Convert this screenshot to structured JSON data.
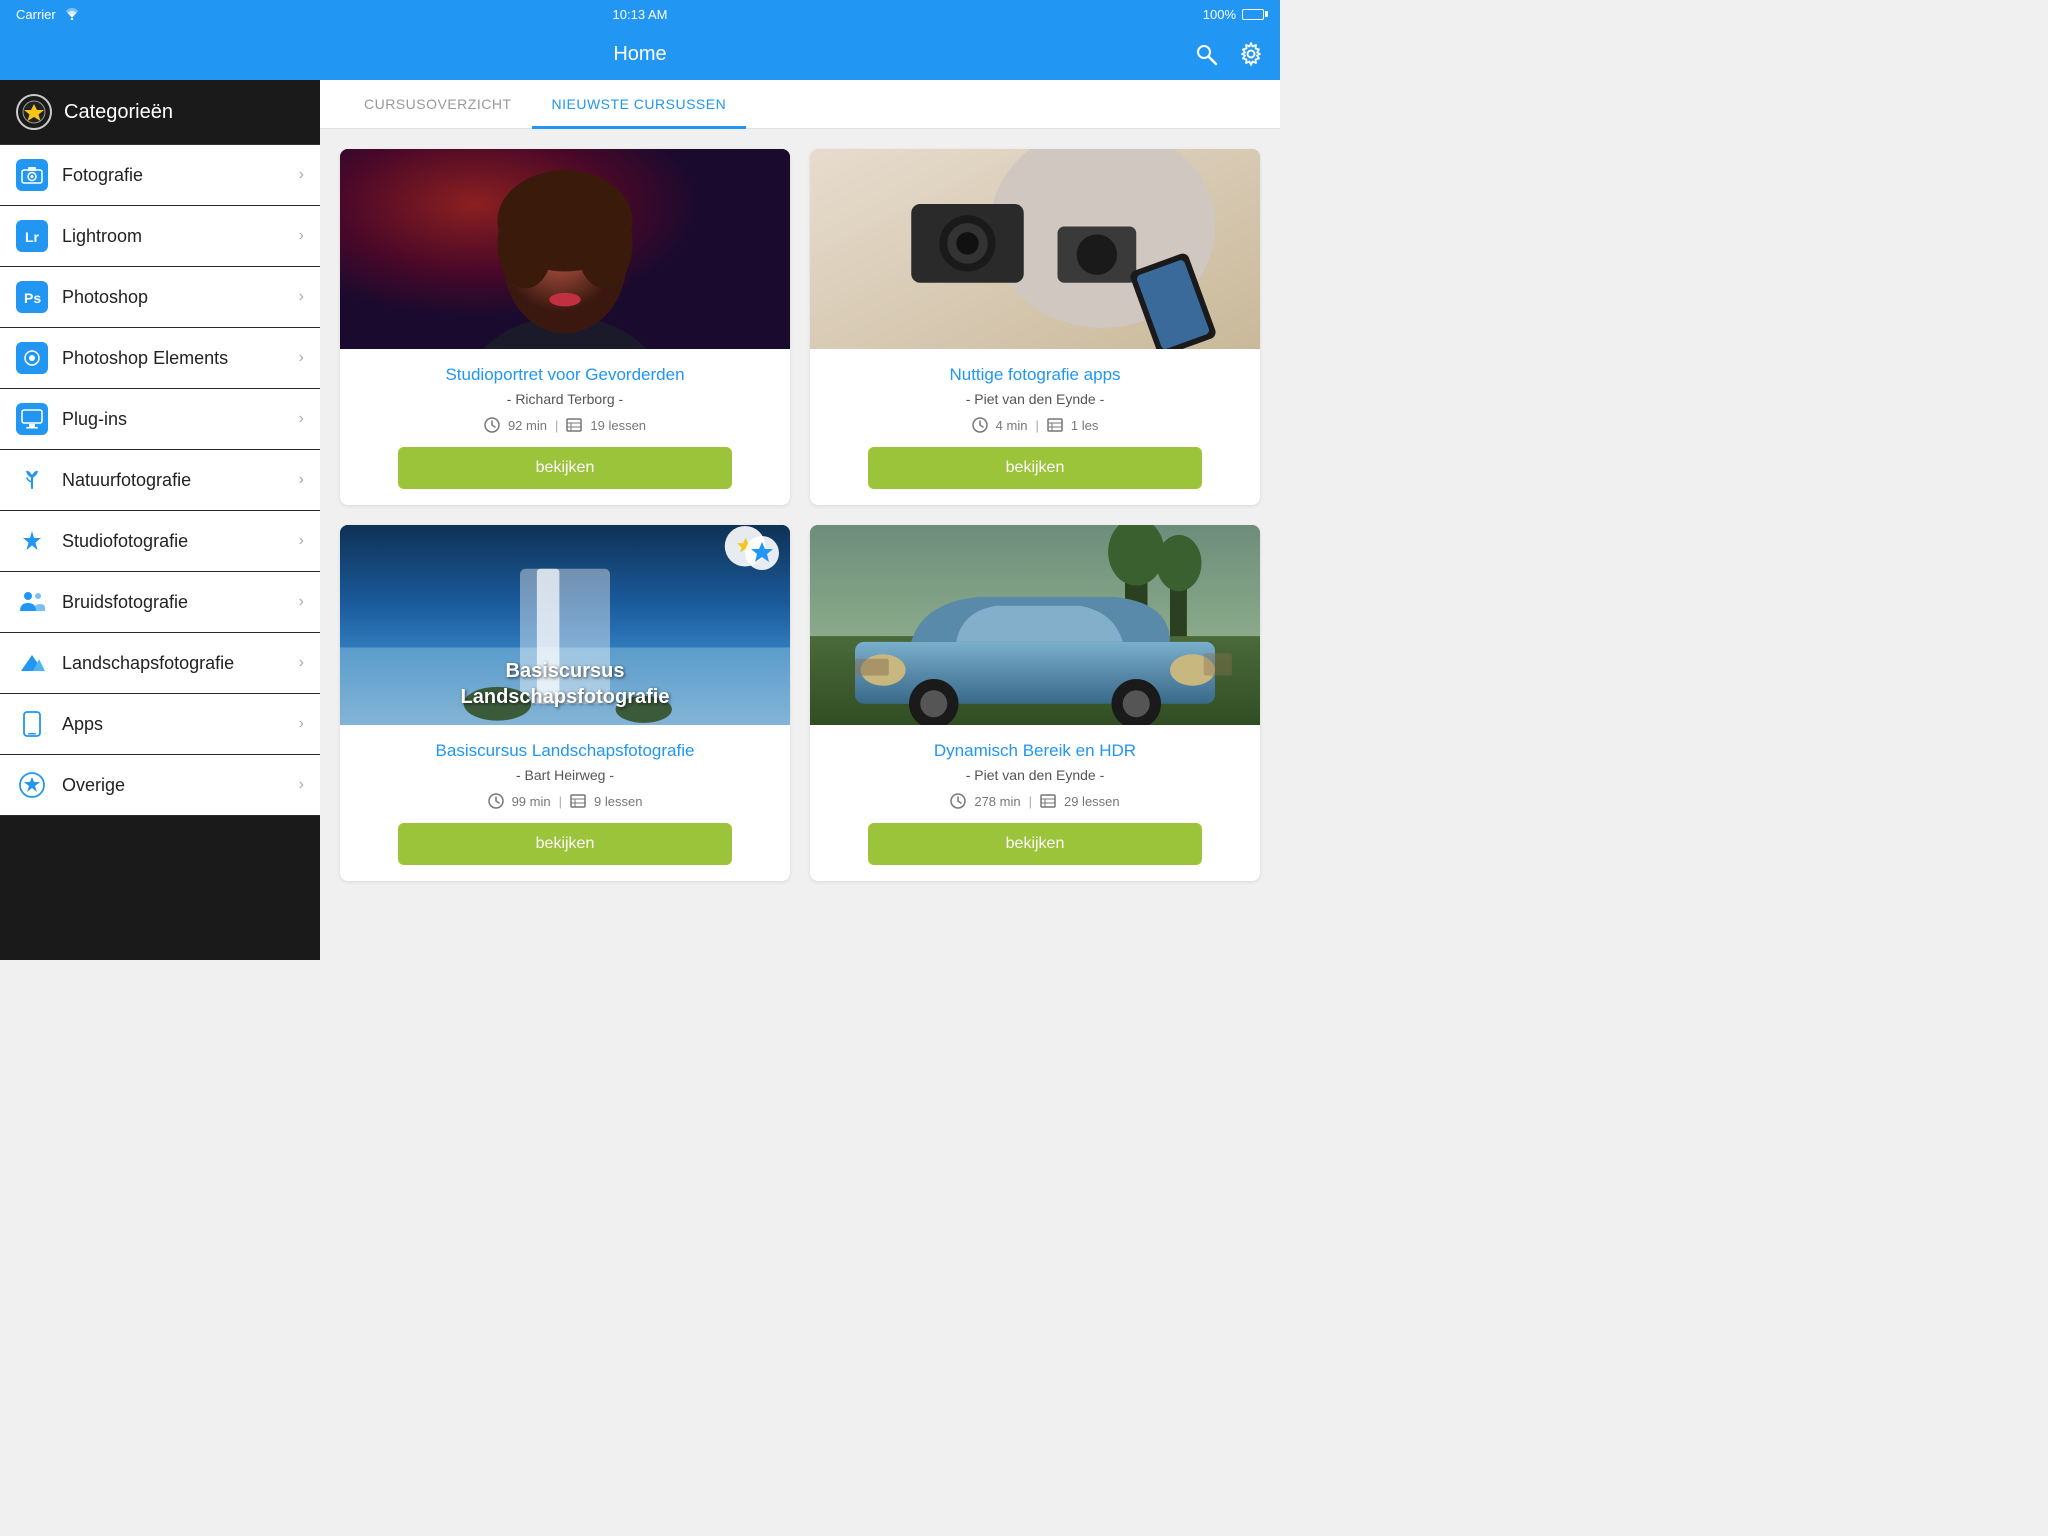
{
  "statusBar": {
    "carrier": "Carrier",
    "time": "10:13 AM",
    "battery": "100%"
  },
  "navBar": {
    "title": "Home"
  },
  "sidebar": {
    "headerTitle": "Categorieën",
    "items": [
      {
        "id": "fotografie",
        "label": "Fotografie",
        "iconType": "camera",
        "iconBg": "#2196F3",
        "iconColor": "white"
      },
      {
        "id": "lightroom",
        "label": "Lightroom",
        "iconType": "L",
        "iconBg": "#2196F3",
        "iconColor": "white"
      },
      {
        "id": "photoshop",
        "label": "Photoshop",
        "iconType": "Ps",
        "iconBg": "#2196F3",
        "iconColor": "white"
      },
      {
        "id": "photoshop-elements",
        "label": "Photoshop Elements",
        "iconType": "Pe",
        "iconBg": "#2196F3",
        "iconColor": "white"
      },
      {
        "id": "plugins",
        "label": "Plug-ins",
        "iconType": "monitor",
        "iconBg": "#2196F3",
        "iconColor": "white"
      },
      {
        "id": "natuurfotografie",
        "label": "Natuurfotografie",
        "iconType": "tulip",
        "iconBg": "transparent",
        "iconColor": "#2196F3"
      },
      {
        "id": "studiofotografie",
        "label": "Studiofotografie",
        "iconType": "star",
        "iconBg": "transparent",
        "iconColor": "#2196F3"
      },
      {
        "id": "bruidsfotografie",
        "label": "Bruidsfotografie",
        "iconType": "people",
        "iconBg": "transparent",
        "iconColor": "#2196F3"
      },
      {
        "id": "landschapsfotografie",
        "label": "Landschapsfotografie",
        "iconType": "mountain",
        "iconBg": "transparent",
        "iconColor": "#2196F3"
      },
      {
        "id": "apps",
        "label": "Apps",
        "iconType": "phone",
        "iconBg": "transparent",
        "iconColor": "#2196F3"
      },
      {
        "id": "overige",
        "label": "Overige",
        "iconType": "star-circle",
        "iconBg": "transparent",
        "iconColor": "#2196F3"
      }
    ]
  },
  "tabs": [
    {
      "id": "cursusoverzicht",
      "label": "CURSUSOVERZICHT",
      "active": false
    },
    {
      "id": "nieuwste-cursussen",
      "label": "NIEUWSTE CURSUSSEN",
      "active": true
    }
  ],
  "courses": [
    {
      "id": "studioportret",
      "title": "Studioportret voor Gevorderden",
      "author": "- Richard Terborg -",
      "duration": "92 min",
      "lessons": "19 lessen",
      "buttonLabel": "bekijken",
      "thumbType": "person"
    },
    {
      "id": "fotografie-apps",
      "title": "Nuttige fotografie apps",
      "author": "- Piet van den Eynde -",
      "duration": "4 min",
      "lessons": "1 les",
      "buttonLabel": "bekijken",
      "thumbType": "cameras"
    },
    {
      "id": "landschapsfotografie-cursus",
      "title": "Basiscursus Landschapsfotografie",
      "author": "- Bart Heirweg -",
      "duration": "99 min",
      "lessons": "9 lessen",
      "buttonLabel": "bekijken",
      "thumbType": "landschap",
      "thumbText": "Basiscursus\nLandschapsfotografie"
    },
    {
      "id": "dynamisch-bereik",
      "title": "Dynamisch Bereik en HDR",
      "author": "- Piet van den Eynde -",
      "duration": "278 min",
      "lessons": "29 lessen",
      "buttonLabel": "bekijken",
      "thumbType": "auto"
    }
  ]
}
